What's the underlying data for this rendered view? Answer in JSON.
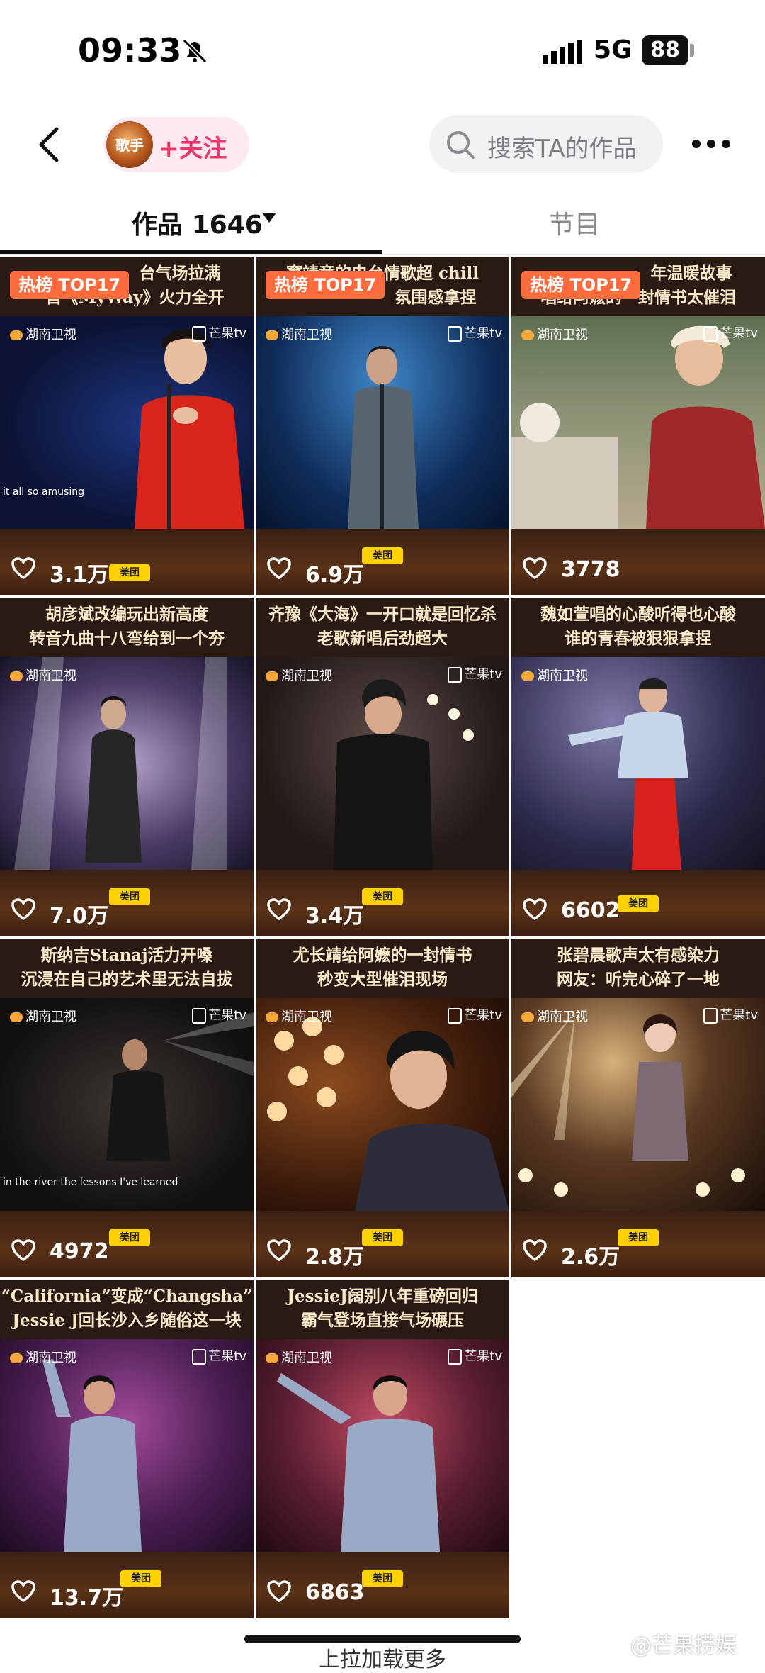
{
  "status_bar": {
    "time": "09:33",
    "network": "5G",
    "battery": "88"
  },
  "nav": {
    "avatar_text": "歌手",
    "follow_label": "+关注",
    "search_placeholder": "搜索TA的作品"
  },
  "tabs": {
    "works_label": "作品",
    "works_count": "1646",
    "shows_label": "节目"
  },
  "hot_badge": "热榜 TOP17",
  "videos": [
    {
      "line1": "台气场拉满",
      "line2": "一首《MyWay》火力全开",
      "likes": "3.1万",
      "hot": true,
      "subtitle": "it all so amusing"
    },
    {
      "line1": "窦靖童的电台情歌超 chill",
      "line2": "氛围感拿捏",
      "likes": "6.9万",
      "hot": true,
      "subtitle": ""
    },
    {
      "line1": "年温暖故事",
      "line2": "唱给阿嬷的一封情书太催泪",
      "likes": "3778",
      "hot": true,
      "subtitle": ""
    },
    {
      "line1": "胡彦斌改编玩出新高度",
      "line2": "转音九曲十八弯给到一个夯",
      "likes": "7.0万",
      "hot": false,
      "subtitle": ""
    },
    {
      "line1": "齐豫《大海》一开口就是回忆杀",
      "line2": "老歌新唱后劲超大",
      "likes": "3.4万",
      "hot": false,
      "subtitle": ""
    },
    {
      "line1": "魏如萱唱的心酸听得也心酸",
      "line2": "谁的青春被狠狠拿捏",
      "likes": "6602",
      "hot": false,
      "subtitle": ""
    },
    {
      "line1": "斯纳吉Stanaj活力开嗓",
      "line2": "沉浸在自己的艺术里无法自拔",
      "likes": "4972",
      "hot": false,
      "subtitle": "in the river the lessons I've learned"
    },
    {
      "line1": "尤长靖给阿嬷的一封情书",
      "line2": "秒变大型催泪现场",
      "likes": "2.8万",
      "hot": false,
      "subtitle": ""
    },
    {
      "line1": "张碧晨歌声太有感染力",
      "line2": "网友：听完心碎了一地",
      "likes": "2.6万",
      "hot": false,
      "subtitle": ""
    },
    {
      "line1": "“California”变成“Changsha”",
      "line2": "Jessie J回长沙入乡随俗这一块",
      "likes": "13.7万",
      "hot": false,
      "subtitle": ""
    },
    {
      "line1": "JessieJ阔别八年重磅回归",
      "line2": "霸气登场直接气场碾压",
      "likes": "6863",
      "hot": false,
      "subtitle": ""
    }
  ],
  "logos": {
    "channel": "湖南卫视",
    "platform": "芒果tv",
    "sponsor": "美团"
  },
  "footer": {
    "load_more": "上拉加载更多",
    "watermark": "@芒果捞娱"
  }
}
